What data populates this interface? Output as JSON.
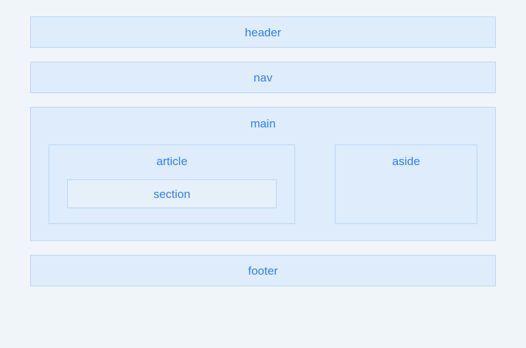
{
  "header": {
    "label": "header"
  },
  "nav": {
    "label": "nav"
  },
  "main": {
    "label": "main",
    "article": {
      "label": "article",
      "section": {
        "label": "section"
      }
    },
    "aside": {
      "label": "aside"
    }
  },
  "footer": {
    "label": "footer"
  }
}
